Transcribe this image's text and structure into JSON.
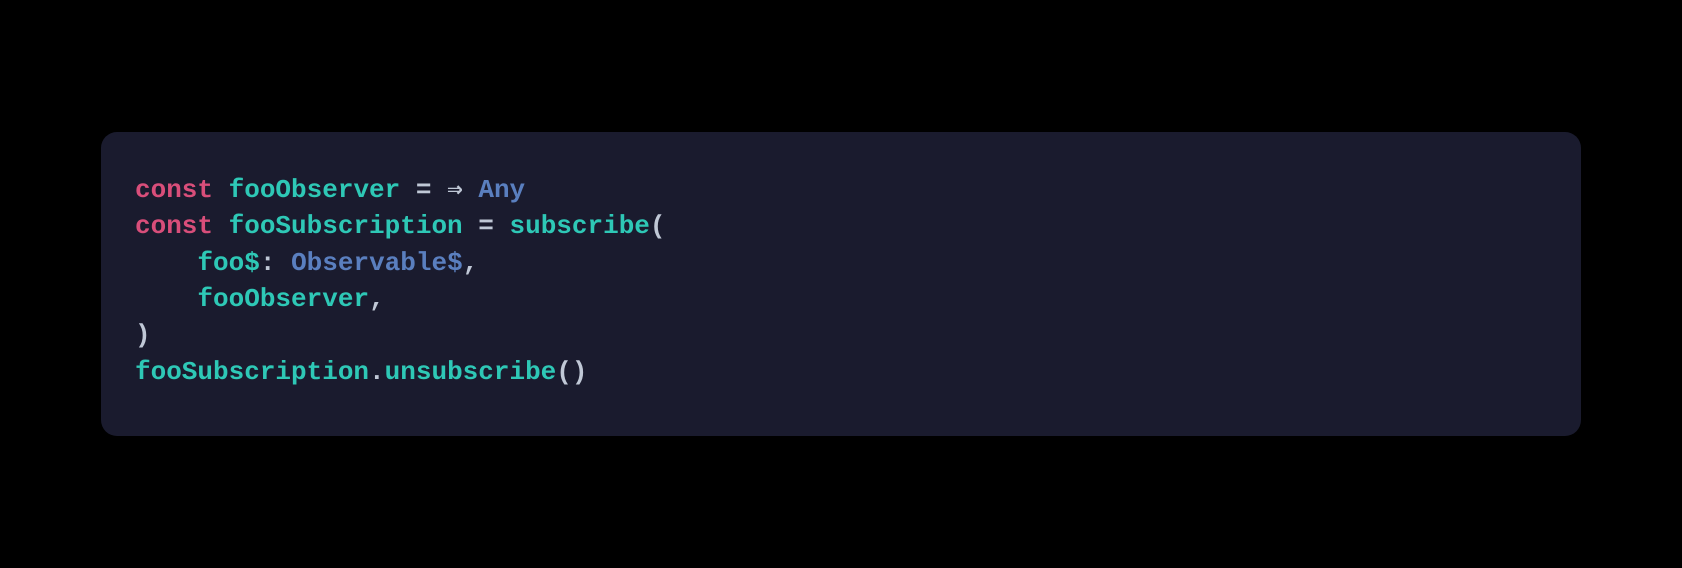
{
  "code": {
    "lines": [
      {
        "indent": "",
        "tokens": [
          {
            "cls": "tok-keyword",
            "text": "const"
          },
          {
            "cls": "tok-op",
            "text": " "
          },
          {
            "cls": "tok-ident",
            "text": "fooObserver"
          },
          {
            "cls": "tok-op",
            "text": " = "
          },
          {
            "cls": "tok-arrow",
            "text": "⇒"
          },
          {
            "cls": "tok-op",
            "text": " "
          },
          {
            "cls": "tok-type",
            "text": "Any"
          }
        ]
      },
      {
        "indent": "",
        "tokens": [
          {
            "cls": "tok-keyword",
            "text": "const"
          },
          {
            "cls": "tok-op",
            "text": " "
          },
          {
            "cls": "tok-ident",
            "text": "fooSubscription"
          },
          {
            "cls": "tok-op",
            "text": " = "
          },
          {
            "cls": "tok-ident",
            "text": "subscribe"
          },
          {
            "cls": "tok-punct",
            "text": "("
          }
        ]
      },
      {
        "indent": "    ",
        "tokens": [
          {
            "cls": "tok-ident",
            "text": "foo$"
          },
          {
            "cls": "tok-punct",
            "text": ":"
          },
          {
            "cls": "tok-op",
            "text": " "
          },
          {
            "cls": "tok-type",
            "text": "Observable$"
          },
          {
            "cls": "tok-punct",
            "text": ","
          }
        ]
      },
      {
        "indent": "    ",
        "tokens": [
          {
            "cls": "tok-ident",
            "text": "fooObserver"
          },
          {
            "cls": "tok-punct",
            "text": ","
          }
        ]
      },
      {
        "indent": "",
        "tokens": [
          {
            "cls": "tok-punct",
            "text": ")"
          }
        ]
      },
      {
        "indent": "",
        "tokens": [
          {
            "cls": "tok-ident",
            "text": "fooSubscription"
          },
          {
            "cls": "tok-punct",
            "text": "."
          },
          {
            "cls": "tok-ident",
            "text": "unsubscribe"
          },
          {
            "cls": "tok-punct",
            "text": "()"
          }
        ]
      }
    ]
  }
}
